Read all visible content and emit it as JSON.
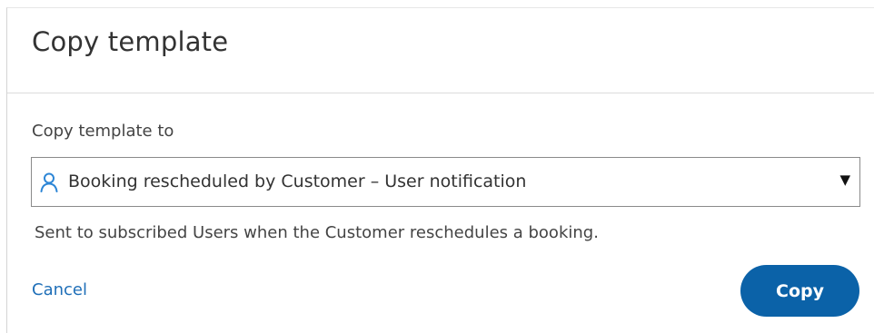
{
  "dialog": {
    "title": "Copy template",
    "field_label": "Copy template to",
    "select": {
      "icon": "user-icon",
      "value": "Booking rescheduled by Customer – User notification",
      "caret_icon": "caret-down-icon"
    },
    "help_text": "Sent to subscribed Users when the Customer reschedules a booking.",
    "cancel_label": "Cancel",
    "copy_label": "Copy"
  },
  "colors": {
    "accent": "#0b62a8",
    "link": "#1f6fb8",
    "icon": "#2d86d6"
  }
}
